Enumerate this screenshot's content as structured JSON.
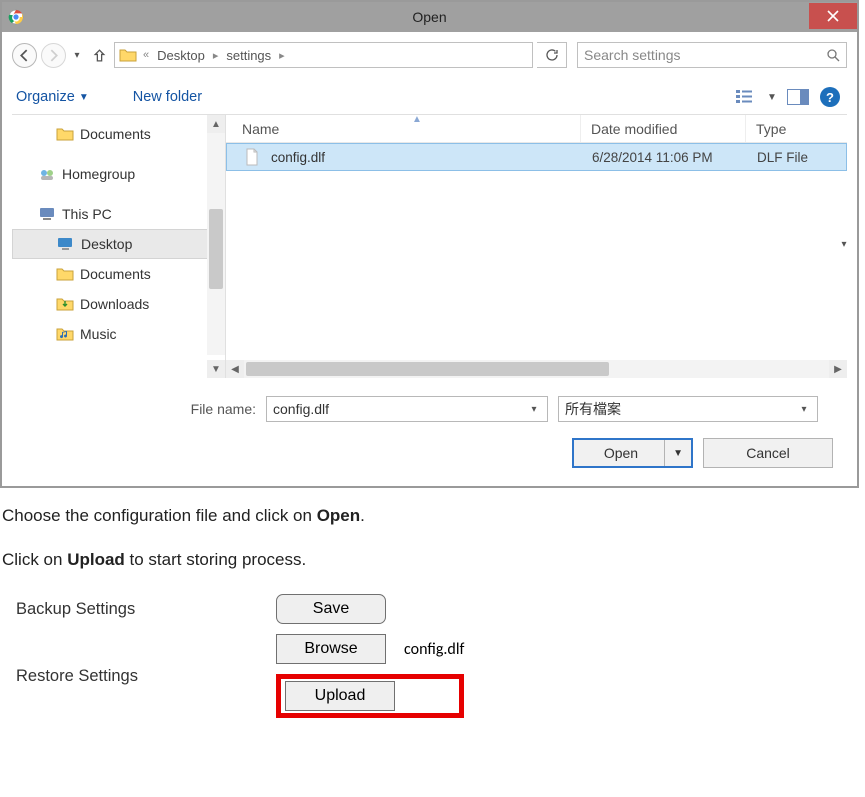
{
  "dialog": {
    "title": "Open",
    "nav": {
      "back_enabled": true,
      "forward_enabled": false,
      "ellipsis": "«",
      "segments": [
        "Desktop",
        "settings"
      ]
    },
    "search_placeholder": "Search settings",
    "toolbar": {
      "organize": "Organize",
      "new_folder": "New folder"
    },
    "tree": [
      {
        "label": "Documents",
        "kind": "folder-yellow",
        "indent": 1
      },
      {
        "gap": true
      },
      {
        "label": "Homegroup",
        "kind": "homegroup",
        "indent": 0
      },
      {
        "gap": true
      },
      {
        "label": "This PC",
        "kind": "computer",
        "indent": 0
      },
      {
        "label": "Desktop",
        "kind": "folder-blue",
        "indent": 1,
        "selected": true
      },
      {
        "label": "Documents",
        "kind": "folder-yellow",
        "indent": 1
      },
      {
        "label": "Downloads",
        "kind": "folder-down",
        "indent": 1
      },
      {
        "label": "Music",
        "kind": "folder-music",
        "indent": 1
      }
    ],
    "list": {
      "columns": {
        "name": "Name",
        "date": "Date modified",
        "type": "Type"
      },
      "rows": [
        {
          "name": "config.dlf",
          "date": "6/28/2014 11:06 PM",
          "type": "DLF File",
          "selected": true
        }
      ]
    },
    "file_name_label": "File name:",
    "file_name_value": "config.dlf",
    "filter_value": "所有檔案",
    "buttons": {
      "open": "Open",
      "cancel": "Cancel"
    }
  },
  "instructions": {
    "line1_pre": "Choose the configuration file and click on ",
    "line1_bold": "Open",
    "line1_post": ".",
    "line2_pre": "Click on ",
    "line2_bold": "Upload",
    "line2_post": " to start storing process."
  },
  "settings": {
    "backup_label": "Backup Settings",
    "restore_label": "Restore Settings",
    "save_btn": "Save",
    "browse_btn": "Browse",
    "upload_btn": "Upload",
    "chosen_file": "config.dlf"
  }
}
